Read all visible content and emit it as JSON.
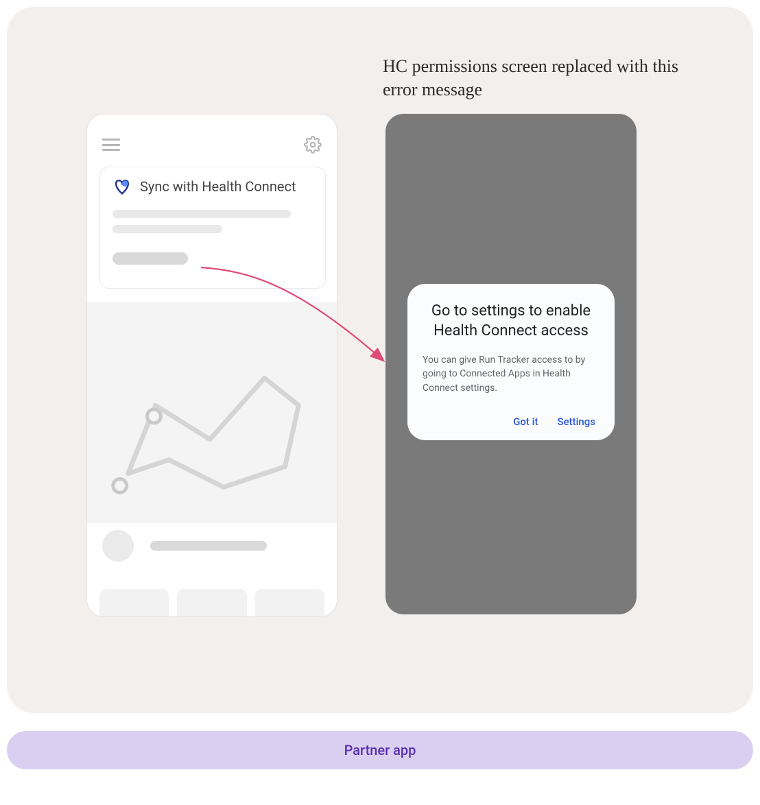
{
  "header": {
    "caption": "HC permissions screen replaced with this error message"
  },
  "partner_app": {
    "sync_card_title": "Sync with Health Connect",
    "icons": {
      "menu": "hamburger-icon",
      "settings": "gear-icon",
      "health_connect": "health-connect-icon"
    }
  },
  "error_dialog": {
    "title": "Go to settings to enable Health Connect access",
    "body": "You can give Run Tracker access to by going to Connected Apps in Health Connect settings.",
    "buttons": {
      "dismiss": "Got it",
      "settings": "Settings"
    }
  },
  "banner": {
    "label": "Partner app"
  },
  "colors": {
    "panel_bg": "#f2efed",
    "phone2_bg": "#7a7a7a",
    "dialog_bg": "#fafcfe",
    "action_blue": "#2a56d8",
    "arrow_pink": "#e04a74",
    "banner_bg": "#dacff0",
    "banner_text": "#5a2fb0"
  }
}
